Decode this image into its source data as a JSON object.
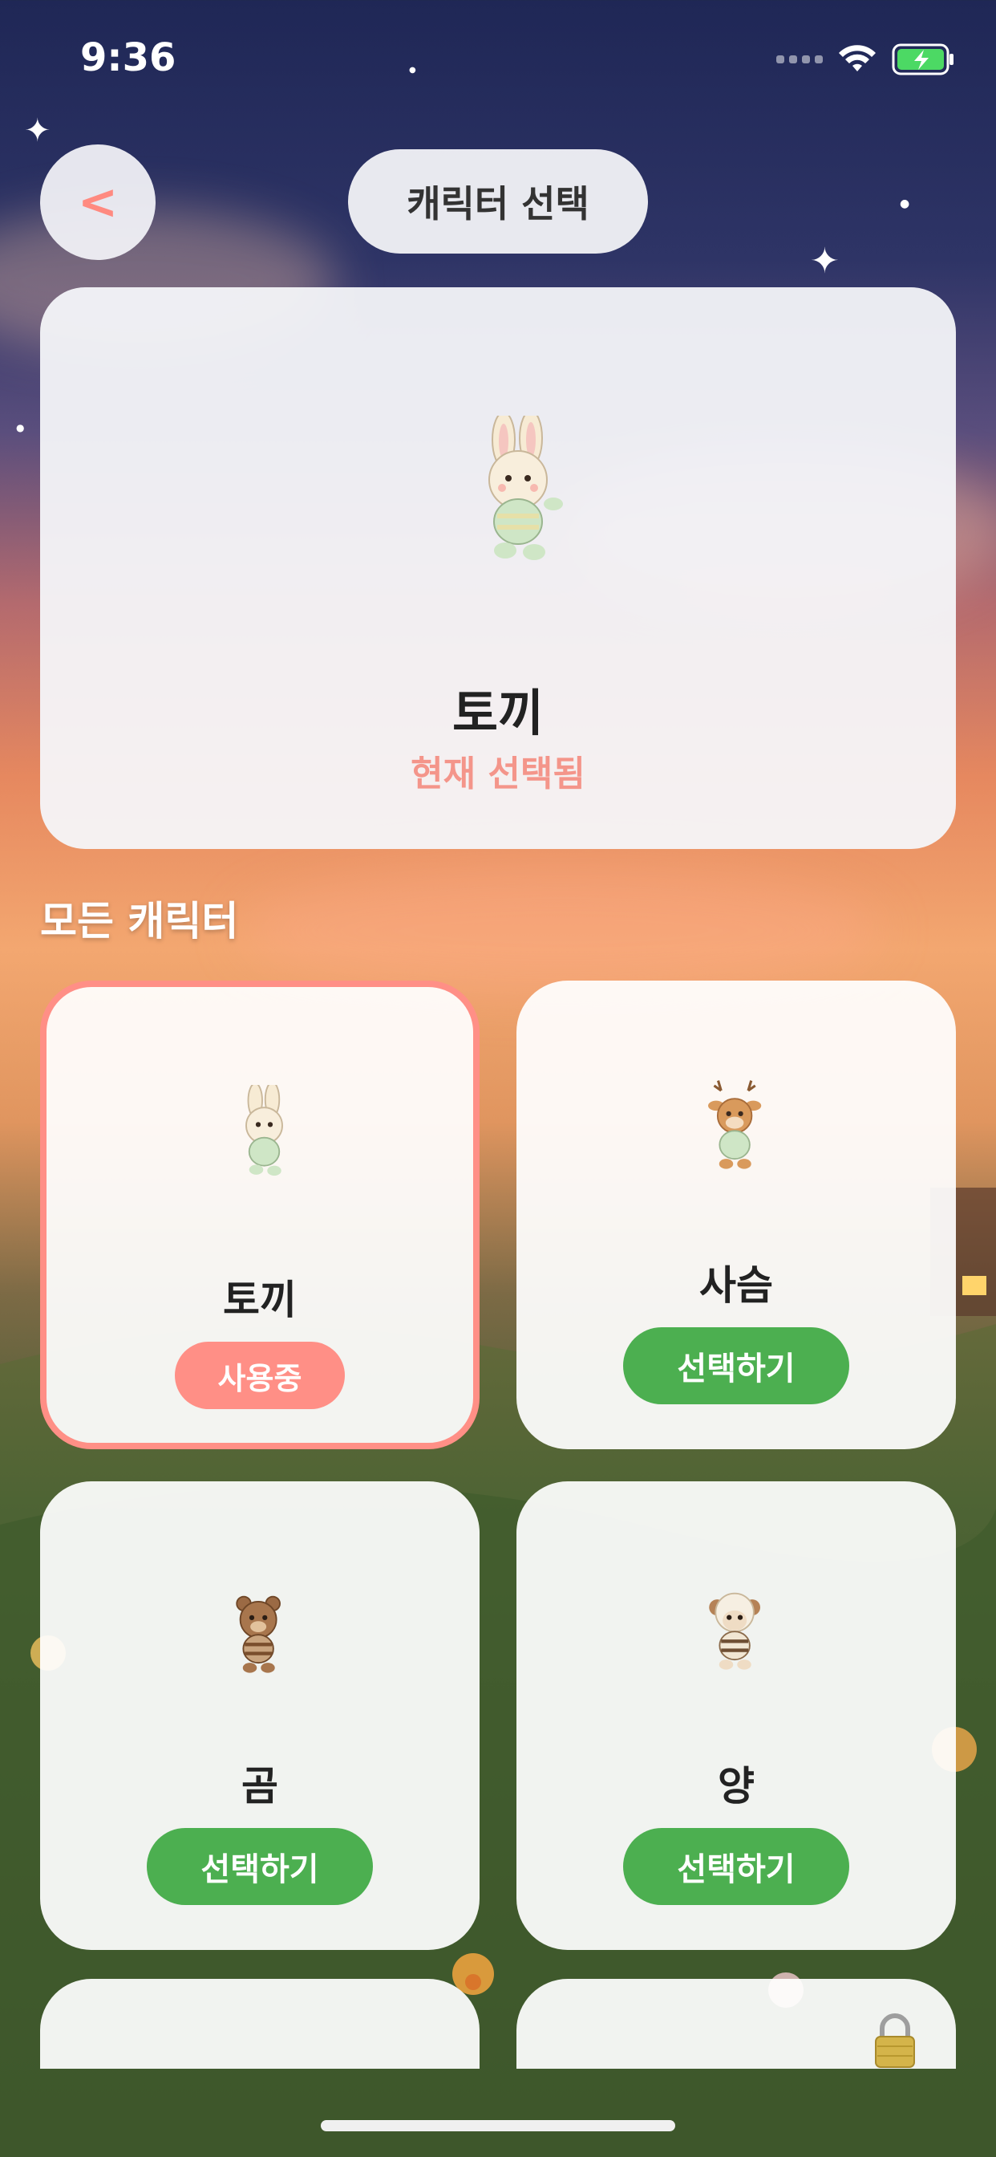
{
  "status_bar": {
    "time": "9:36"
  },
  "header": {
    "title": "캐릭터 선택",
    "back_label": "<"
  },
  "current": {
    "name": "토끼",
    "status": "현재 선택됨"
  },
  "section_title": "모든 캐릭터",
  "characters": [
    {
      "name": "토끼",
      "button": "사용중",
      "selected": true
    },
    {
      "name": "사슴",
      "button": "선택하기",
      "selected": false
    },
    {
      "name": "곰",
      "button": "선택하기",
      "selected": false
    },
    {
      "name": "양",
      "button": "선택하기",
      "selected": false
    }
  ],
  "colors": {
    "accent_pink": "#ff8f86",
    "select_green": "#4caf50",
    "status_pink": "#f4958a"
  },
  "icons": [
    "back-icon",
    "wifi-icon",
    "battery-charging-icon",
    "lock-icon"
  ]
}
